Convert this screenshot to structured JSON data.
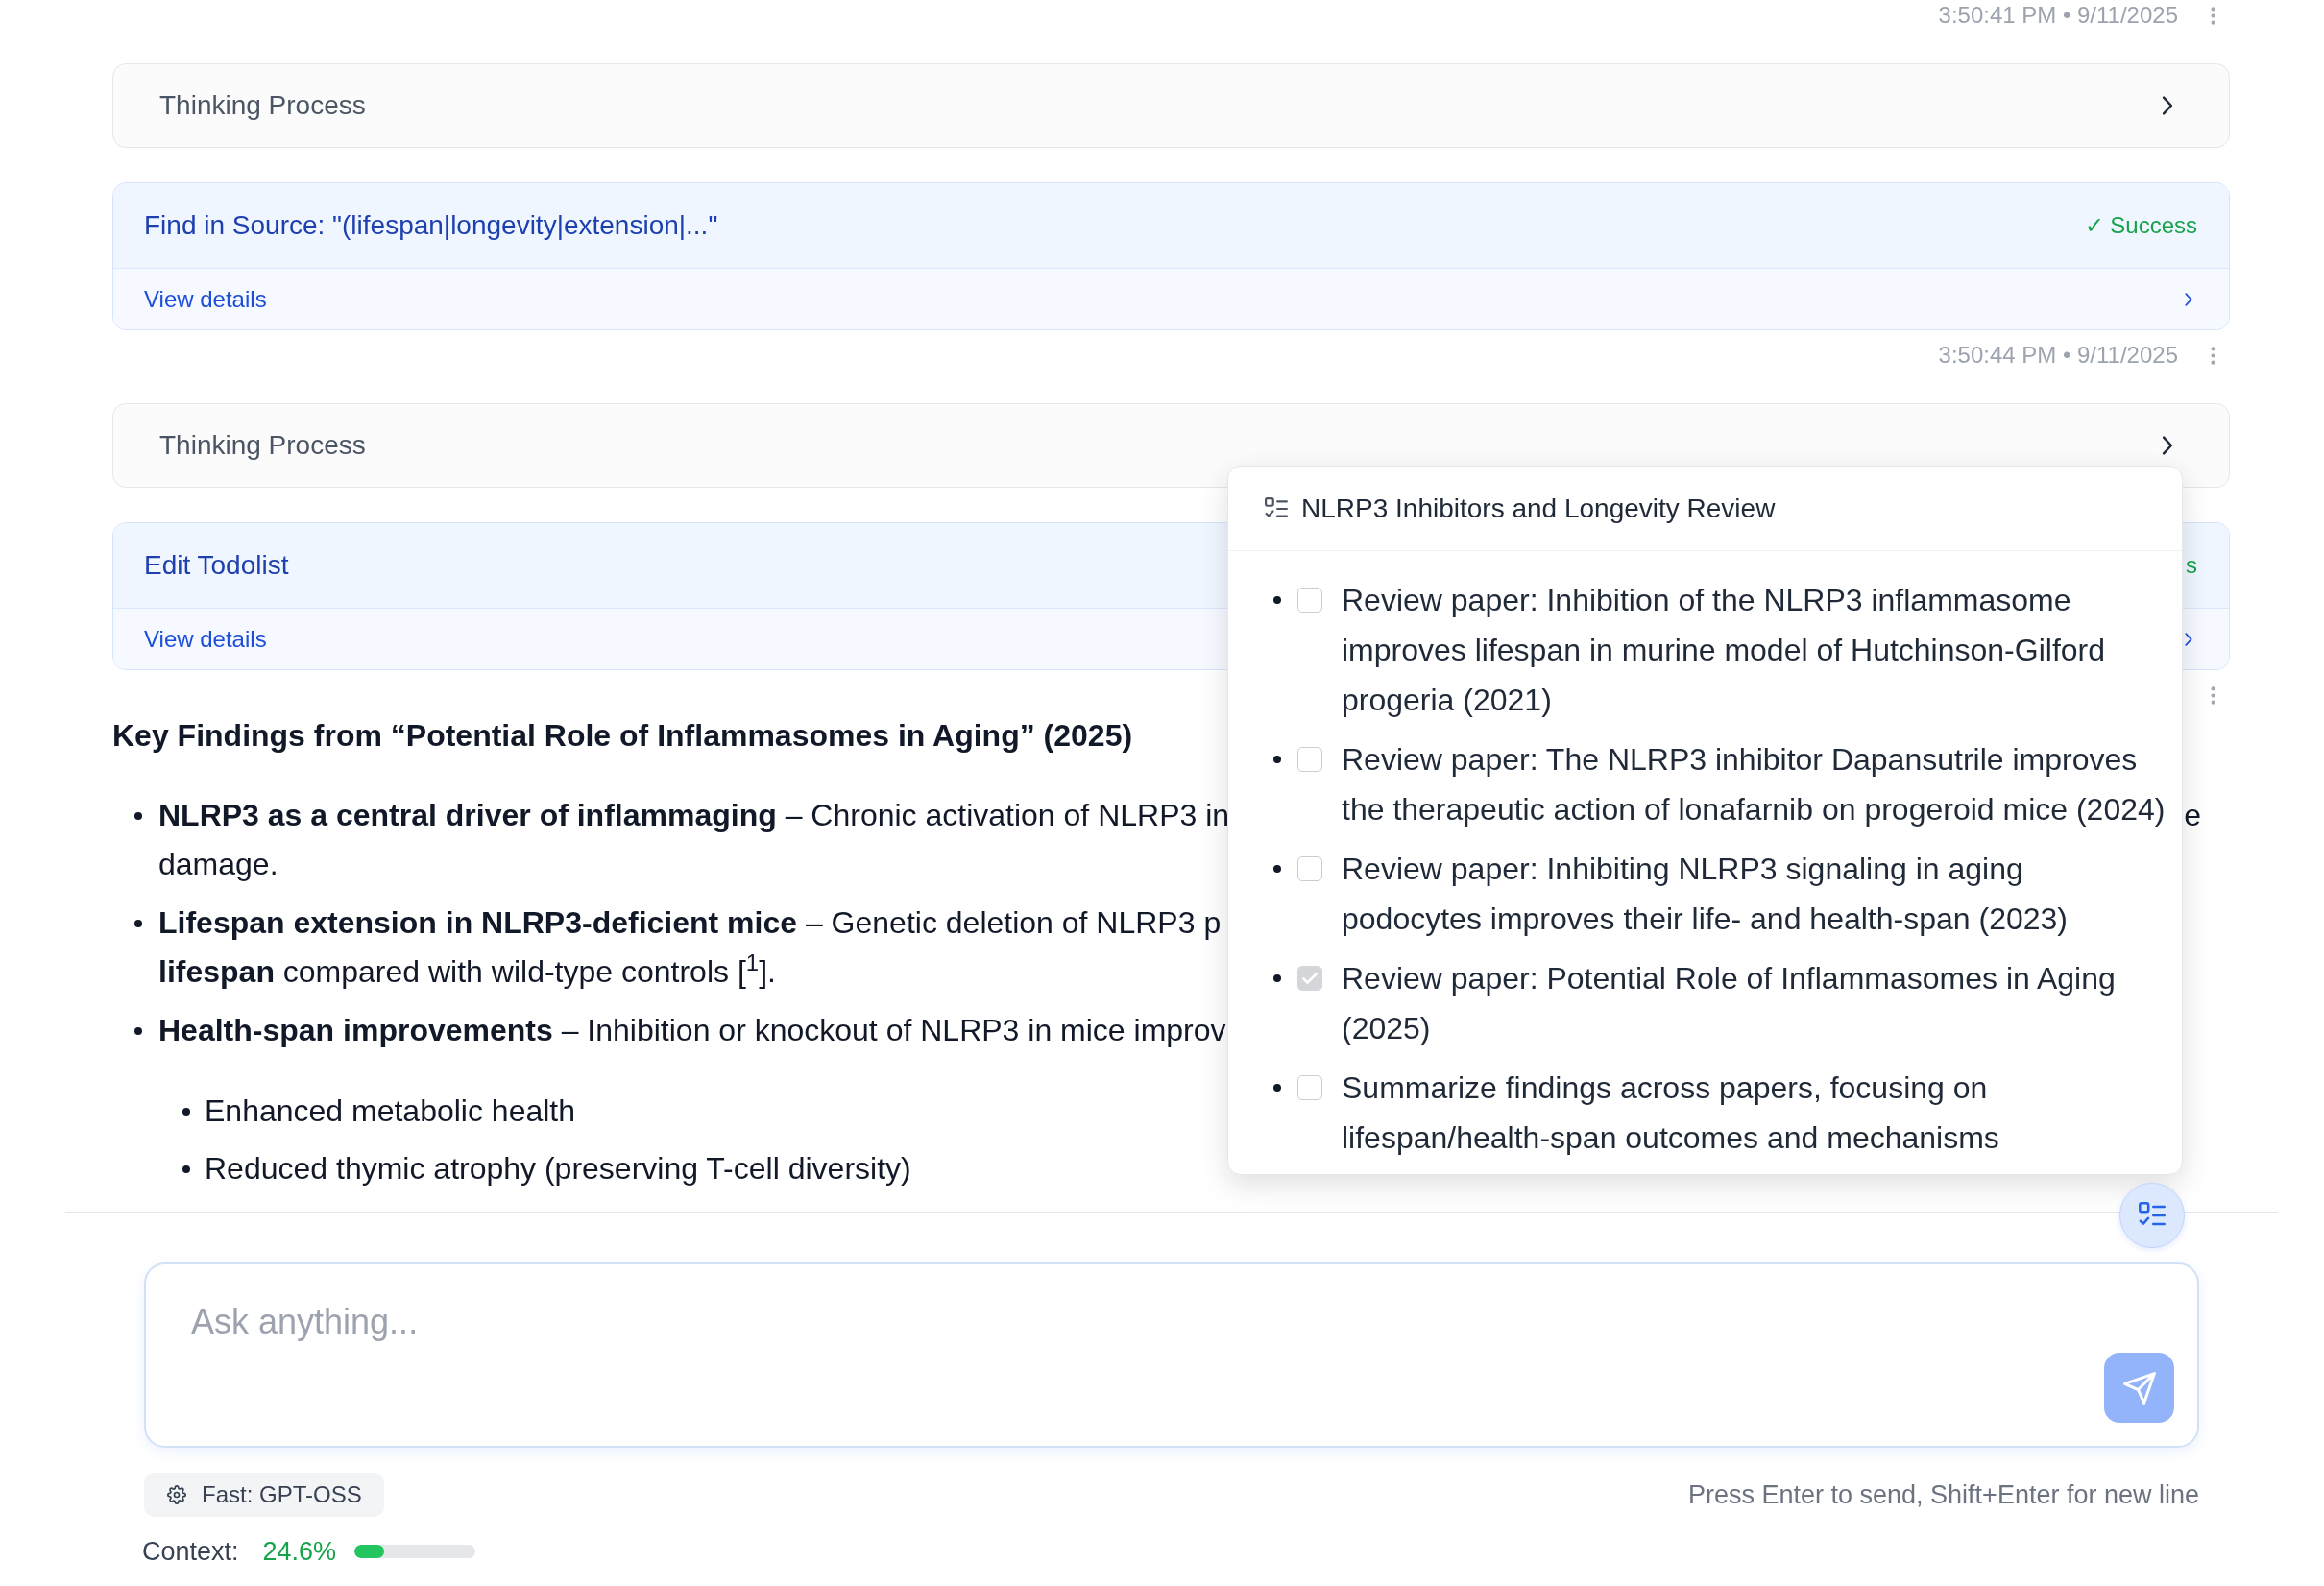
{
  "messages": [
    {
      "kind": "timestamp",
      "time": "3:50:41 PM • 9/11/2025"
    },
    {
      "kind": "thinking",
      "label": "Thinking Process",
      "expanded": false
    },
    {
      "kind": "tool",
      "title": "Find in Source: \"(lifespan|longevity|extension|...\"",
      "status": "✓ Success",
      "details": "View details"
    },
    {
      "kind": "timestamp",
      "time": "3:50:44 PM • 9/11/2025"
    },
    {
      "kind": "thinking",
      "label": "Thinking Process",
      "expanded": false
    },
    {
      "kind": "tool",
      "title": "Edit Todolist",
      "status": "s",
      "details": "View details"
    },
    {
      "kind": "timestamp"
    },
    {
      "kind": "answer",
      "heading": "Key Findings from “Potential Role of Inflammasomes in Aging” (2025)",
      "items": [
        {
          "lines": [
            {
              "text": "**NLRP3 as a central driver of inflammaging** – Chronic activation of NLRP3 in",
              "tail": "e"
            },
            {
              "text": "damage."
            }
          ]
        },
        {
          "lines": [
            {
              "text": "**Lifespan extension in NLRP3-deficient mice** – Genetic deletion of NLRP3 p"
            },
            {
              "text": "**lifespan** compared with wild-type controls [$^{1}$]."
            }
          ]
        },
        {
          "lines": [
            {
              "text": "**Health-span improvements** – Inhibition or knockout of NLRP3 in mice improv"
            }
          ],
          "children": [
            {
              "text": "Enhanced metabolic health"
            },
            {
              "text": "Reduced thymic atrophy (preserving T-cell diversity)"
            }
          ]
        }
      ]
    }
  ],
  "todo_panel": {
    "title": "NLRP3 Inhibitors and Longevity Review",
    "items": [
      {
        "text": "Review paper: Inhibition of the NLRP3 inflammasome improves lifespan in murine model of Hutchinson-Gilford progeria (2021)",
        "checked": false
      },
      {
        "text": "Review paper: The NLRP3 inhibitor Dapansutrile improves the therapeutic action of lonafarnib on progeroid mice (2024)",
        "checked": false
      },
      {
        "text": "Review paper: Inhibiting NLRP3 signaling in aging podocytes improves their life- and health-span (2023)",
        "checked": false
      },
      {
        "text": "Review paper: Potential Role of Inflammasomes in Aging (2025)",
        "checked": true
      },
      {
        "text": "Summarize findings across papers, focusing on lifespan/health-span outcomes and mechanisms",
        "checked": false
      }
    ]
  },
  "composer": {
    "placeholder": "Ask anything...",
    "model": "Fast: GPT-OSS",
    "hint": "Press Enter to send, Shift+Enter for new line",
    "context_label": "Context:",
    "context_reading": "24.6%",
    "context_meter": {
      "level": 0.246
    }
  }
}
